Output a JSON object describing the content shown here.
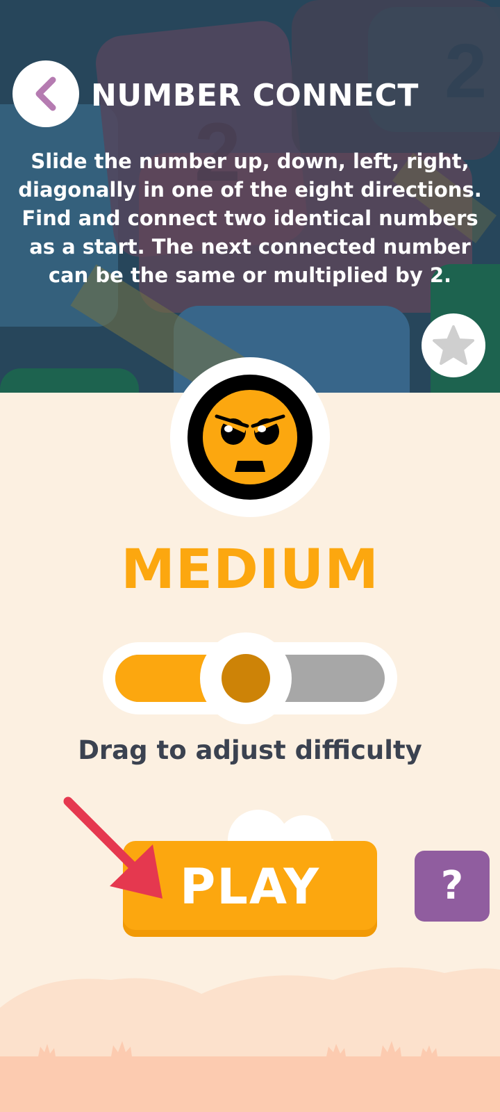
{
  "header": {
    "title": "NUMBER CONNECT",
    "instructions": "Slide the number up, down, left, right, diagonally in one of the eight directions. Find and connect two identical numbers as a start. The next connected number can be the same or multiplied by 2.",
    "back_icon": "chevron-left-icon",
    "favorite_icon": "star-icon"
  },
  "difficulty": {
    "label": "MEDIUM",
    "level_fraction": 0.5,
    "hint": "Drag to adjust difficulty",
    "face_icon": "angry-face-icon"
  },
  "actions": {
    "play_label": "PLAY",
    "help_label": "?"
  },
  "colors": {
    "accent": "#fca70f",
    "accent_dark": "#cd8307",
    "header_bg": "#2b4a5e",
    "page_bg": "#fcf0e1",
    "help_bg": "#905d9f",
    "back_chevron": "#b57bb1",
    "arrow": "#e5384f",
    "track_gray": "#a7a7a7",
    "text_dark": "#3b4250"
  }
}
